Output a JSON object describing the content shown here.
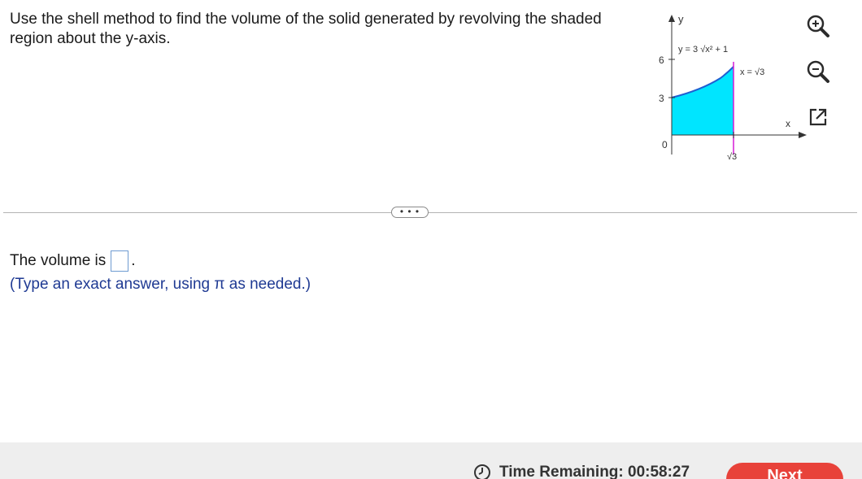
{
  "question": {
    "text": "Use the shell method to find the volume of the solid generated by revolving the shaded region about the y-axis."
  },
  "graph": {
    "axis_y_label": "y",
    "axis_x_label": "x",
    "curve_label": "y = 3 √x² + 1",
    "line_label": "x = √3",
    "y_tick_6": "6",
    "y_tick_3": "3",
    "origin_label": "0",
    "x_tick_root3": "√3",
    "fill_color": "#00e5ff",
    "curve_color": "#1f5fd1",
    "line_color": "#d61ad6"
  },
  "tools": {
    "zoom_in": "zoom-in",
    "zoom_out": "zoom-out",
    "popout": "pop-out"
  },
  "divider": {
    "more_label": "• • •"
  },
  "answer": {
    "prefix": "The volume is",
    "suffix": ".",
    "hint": "(Type an exact answer, using π as needed.)"
  },
  "footer": {
    "timer_label": "Time Remaining: 00:58:27",
    "next_label": "Next",
    "next_color": "#e8423a"
  }
}
